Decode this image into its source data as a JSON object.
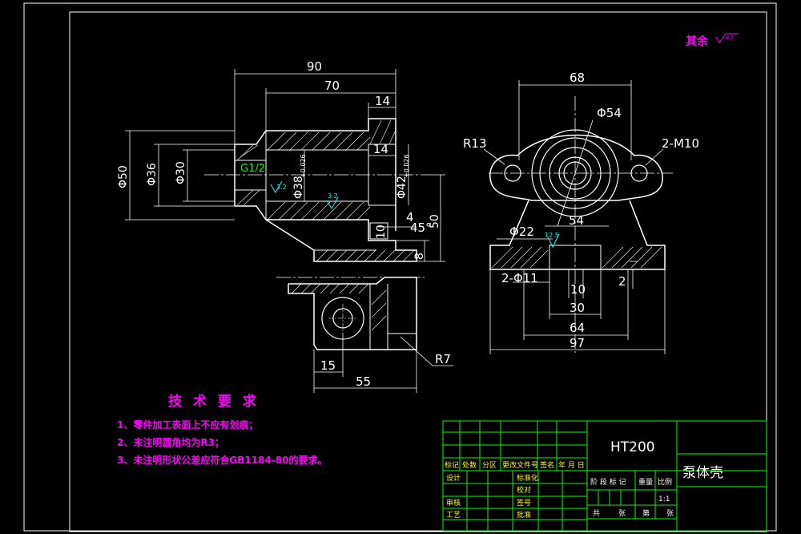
{
  "surface_note": "其余",
  "surface_symbol": "6.3",
  "front_view": {
    "dims": {
      "d90": "90",
      "d70": "70",
      "d14a": "14",
      "d14b": "14",
      "phi50": "Φ50",
      "phi36": "Φ36",
      "phi30": "Φ30",
      "thread": "G1/2",
      "phi38": "Φ38",
      "phi38_tol": "+0.026",
      "phi42": "Φ42",
      "phi42_tol": "+0.026",
      "rough1": "3.2",
      "rough2": "3.2",
      "d4": "4",
      "chamfer": "45°",
      "d10": "10",
      "d50": "50",
      "d8": "8"
    }
  },
  "bottom_view": {
    "dims": {
      "d15": "15",
      "d55": "55",
      "r7": "R7"
    }
  },
  "side_view": {
    "dims": {
      "d68": "68",
      "phi54": "Φ54",
      "r13": "R13",
      "m10": "2-M10",
      "phi22": "Φ22",
      "rough": "12.5",
      "d54": "54",
      "phi11": "2-Φ11",
      "d10": "10",
      "d2": "2",
      "d30": "30",
      "d64": "64",
      "d97": "97"
    }
  },
  "tech": {
    "title": "技 术 要 求",
    "items": [
      "1、零件加工表面上不应有划痕；",
      "2、未注明圆角均为R3；",
      "3、未注明形状公差应符合GB1184-80的要求。"
    ]
  },
  "title_block": {
    "material": "HT200",
    "part_name": "泵体壳",
    "rev_headers": [
      "标记",
      "处数",
      "分区",
      "更改文件号",
      "签名",
      "年 月 日"
    ],
    "role_design": "设计",
    "role_std": "标准化",
    "role_check": "审核",
    "role_craft": "工艺",
    "role_review": "校对",
    "role_sign": "签号",
    "role_approve": "批准",
    "stage_headers": [
      "阶 段 标 记",
      "重量",
      "比例"
    ],
    "scale": "1:1",
    "sheet_footer": [
      "共",
      "张",
      "第",
      "张"
    ]
  }
}
